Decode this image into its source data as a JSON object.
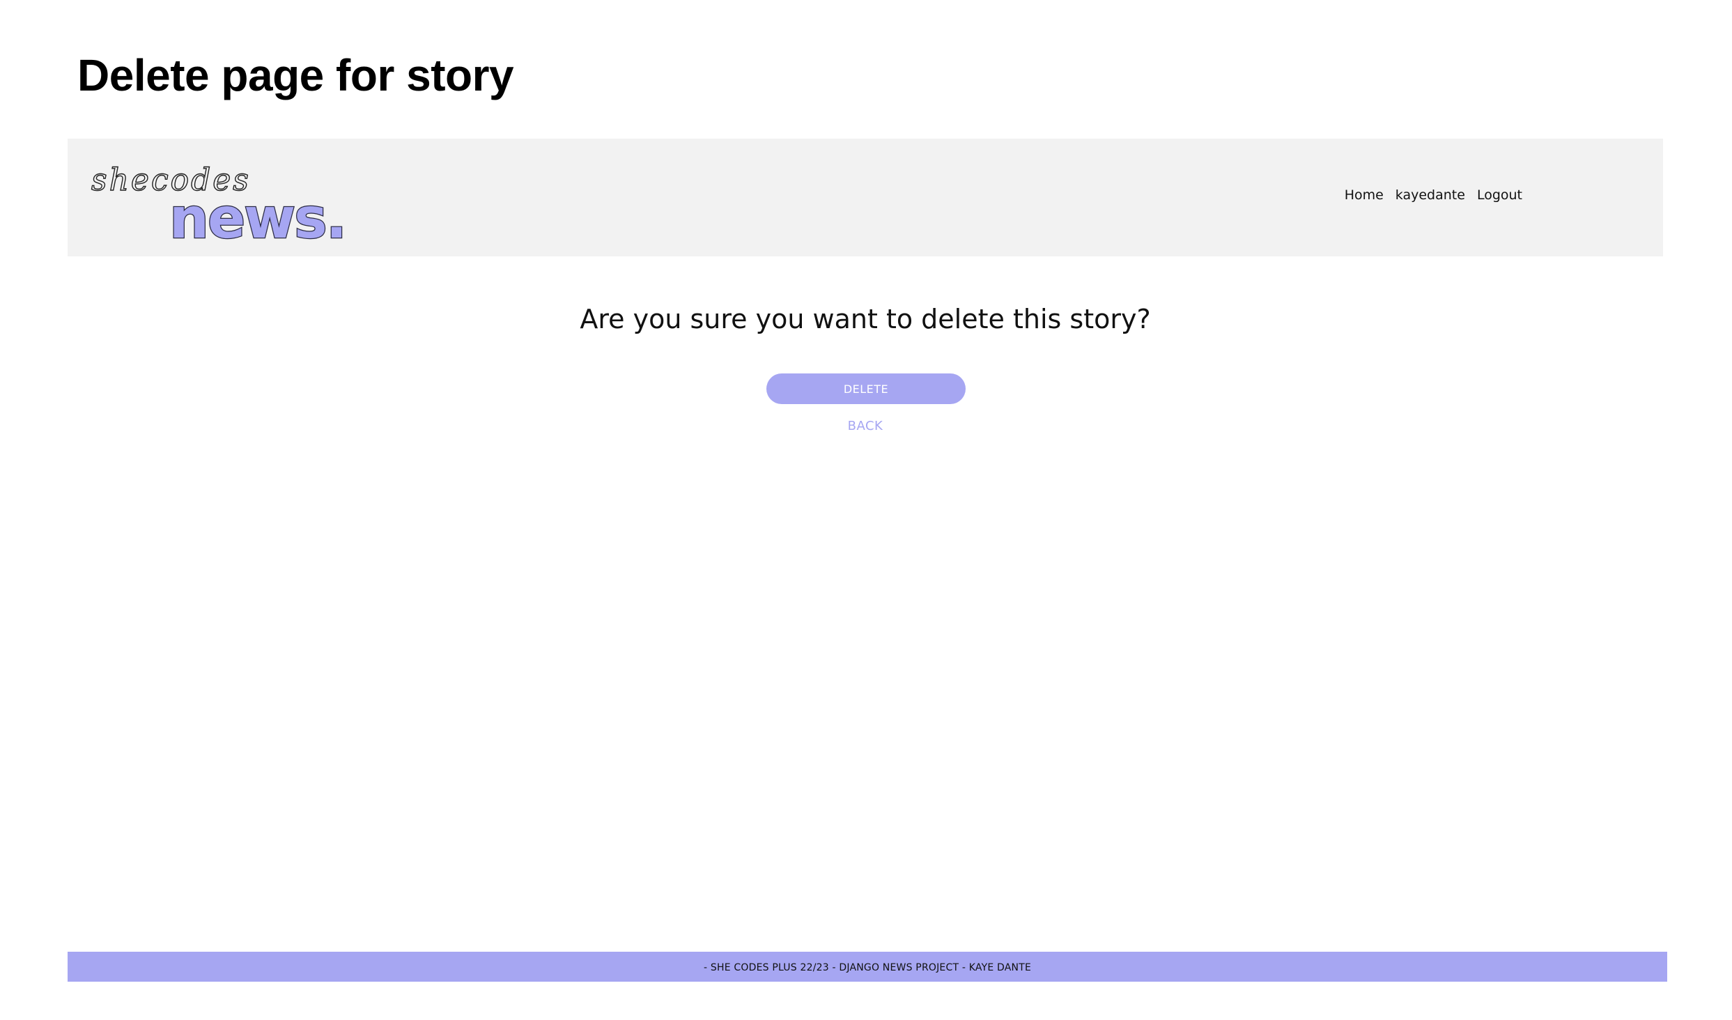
{
  "page": {
    "title": "Delete page for story"
  },
  "header": {
    "logo": {
      "script_text": "shecodes",
      "wordmark_text": "news."
    },
    "nav": [
      {
        "label": "Home"
      },
      {
        "label": "kayedante"
      },
      {
        "label": "Logout"
      }
    ]
  },
  "main": {
    "heading": "Are you sure you want to delete this story?",
    "delete_label": "DELETE",
    "back_label": "BACK"
  },
  "footer": {
    "text": "- SHE CODES PLUS 22/23 - DJANGO NEWS PROJECT - KAYE DANTE"
  },
  "colors": {
    "accent": "#a6a6f2",
    "navbar_bg": "#f2f2f2",
    "text": "#111111",
    "background": "#ffffff"
  }
}
